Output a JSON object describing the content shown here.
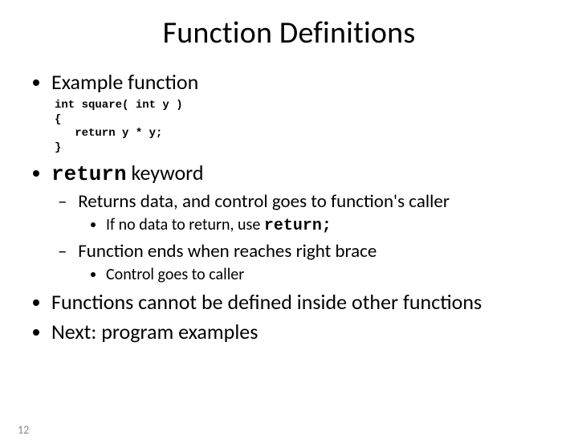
{
  "title": "Function Definitions",
  "bullets": {
    "b1": "Example function",
    "code": "int square( int y )\n{\n   return y * y;\n}",
    "b2_kw": "return",
    "b2_rest": " keyword",
    "b2_s1": "Returns data, and control goes to function's caller",
    "b2_s1_a_pre": "If no data to return, use ",
    "b2_s1_a_kw": "return;",
    "b2_s2": "Function ends when reaches right brace",
    "b2_s2_a": "Control goes to caller",
    "b3": "Functions cannot be defined inside other functions",
    "b4": "Next: program examples"
  },
  "page_number": "12"
}
